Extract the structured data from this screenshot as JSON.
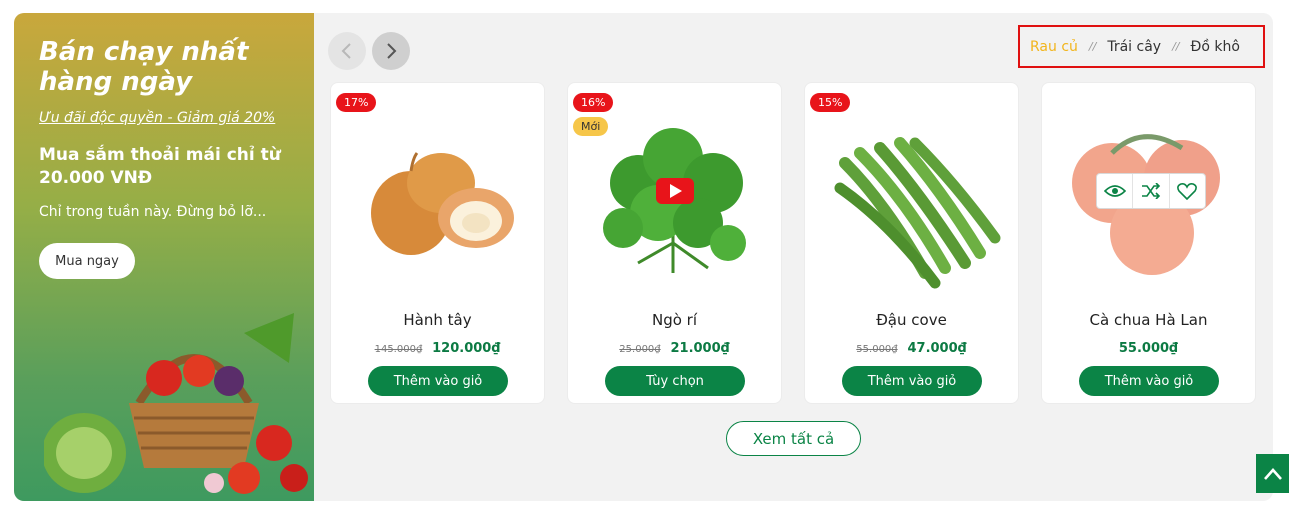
{
  "promo": {
    "title": "Bán chạy nhất hàng ngày",
    "deal": "Ưu đãi độc quyền - Giảm giá 20%",
    "from": "Mua sắm thoải mái chỉ từ 20.000 VNĐ",
    "week": "Chỉ trong tuần này. Đừng bỏ lỡ...",
    "button": "Mua ngay"
  },
  "tabs": [
    "Rau củ",
    "Trái cây",
    "Đồ khô"
  ],
  "products": [
    {
      "badge": "17%",
      "name": "Hành tây",
      "old_price": "145.000₫",
      "price": "120.000₫",
      "button": "Thêm vào giỏ"
    },
    {
      "badge": "16%",
      "badge_new": "Mới",
      "name": "Ngò rí",
      "old_price": "25.000₫",
      "price": "21.000₫",
      "button": "Tùy chọn"
    },
    {
      "badge": "15%",
      "name": "Đậu cove",
      "old_price": "55.000₫",
      "price": "47.000₫",
      "button": "Thêm vào giỏ"
    },
    {
      "name": "Cà chua Hà Lan",
      "price": "55.000₫",
      "button": "Thêm vào giỏ"
    }
  ],
  "view_all": "Xem tất cả",
  "colors": {
    "accent_green": "#0b8446",
    "active_tab": "#f2b51c",
    "badge_red": "#e8141a"
  }
}
